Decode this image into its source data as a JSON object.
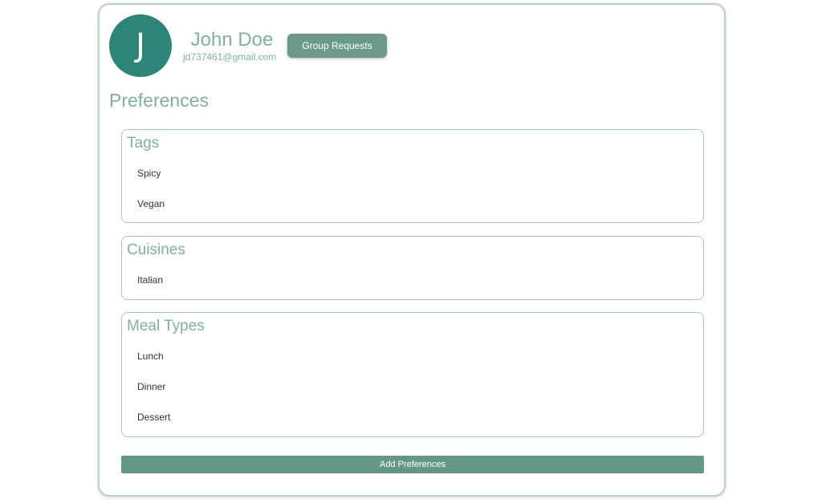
{
  "profile": {
    "avatar_initial": "J",
    "name": "John Doe",
    "email": "jd737461@gmail.com"
  },
  "header": {
    "group_requests_label": "Group Requests"
  },
  "preferences": {
    "title": "Preferences",
    "tags": {
      "title": "Tags",
      "items": [
        "Spicy",
        "Vegan"
      ]
    },
    "cuisines": {
      "title": "Cuisines",
      "items": [
        "Italian"
      ]
    },
    "meal_types": {
      "title": "Meal Types",
      "items": [
        "Lunch",
        "Dinner",
        "Dessert"
      ]
    },
    "add_label": "Add Preferences"
  },
  "colors": {
    "accent": "#7fb0a0",
    "avatar": "#2c8577",
    "button": "#6b9a8a"
  }
}
